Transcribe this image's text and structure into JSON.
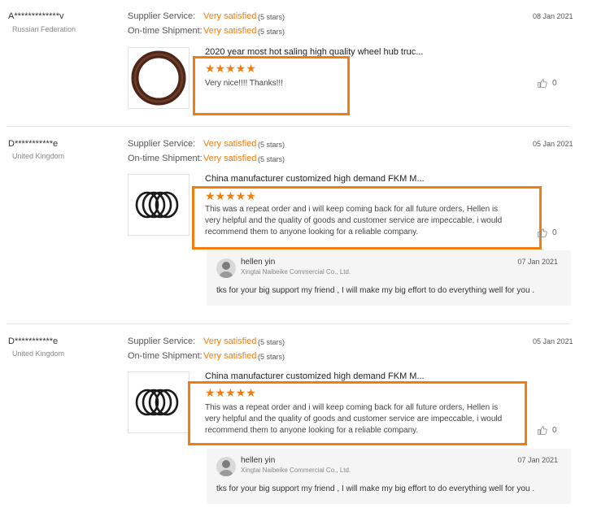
{
  "labels": {
    "supplier_service": "Supplier Service:",
    "ontime_shipment": "On-time Shipment:",
    "very_satisfied": "Very satisfied",
    "five_stars": "(5 stars)",
    "rating_stars": "★★★★★"
  },
  "colors": {
    "accent": "#f07d10",
    "highlight_border": "#f07d10"
  },
  "icons": {
    "like": "thumbs-up-icon",
    "avatar": "user-avatar-icon"
  },
  "reviews": [
    {
      "buyer": "A*************v",
      "country": "Russian Federation",
      "date": "08 Jan 2021",
      "product_title": "2020 year most hot saling high quality wheel hub truc...",
      "product_image": "steering-wheel-cover",
      "rating": 5,
      "text": "Very nice!!!! Thanks!!!",
      "likes": "0"
    },
    {
      "buyer": "D***********e",
      "country": "United Kingdom",
      "date": "05 Jan 2021",
      "product_title": "China manufacturer customized high demand FKM M...",
      "product_image": "o-rings",
      "rating": 5,
      "text": "This was a repeat order and i will keep coming back for all future orders, Hellen is very helpful and the quality of goods and customer service are impeccable, i would recommend them to anyone looking for a reliable company.",
      "likes": "0",
      "reply": {
        "name": "hellen yin",
        "company": "Xingtai Naibeike Commercial Co., Ltd.",
        "date": "07 Jan 2021",
        "message": "tks for your big support my friend , I will make my big effort to do everything well for you ."
      }
    },
    {
      "buyer": "D***********e",
      "country": "United Kingdom",
      "date": "05 Jan 2021",
      "product_title": "China manufacturer customized high demand FKM M...",
      "product_image": "o-rings",
      "rating": 5,
      "text": "This was a repeat order and i will keep coming back for all future orders, Hellen is very helpful and the quality of goods and customer service are impeccable, i would recommend them to anyone looking for a reliable company.",
      "likes": "0",
      "reply": {
        "name": "hellen yin",
        "company": "Xingtai Naibeike Commercial Co., Ltd.",
        "date": "07 Jan 2021",
        "message": "tks for your big support my friend , I will make my big effort to do everything well for you ."
      }
    }
  ]
}
